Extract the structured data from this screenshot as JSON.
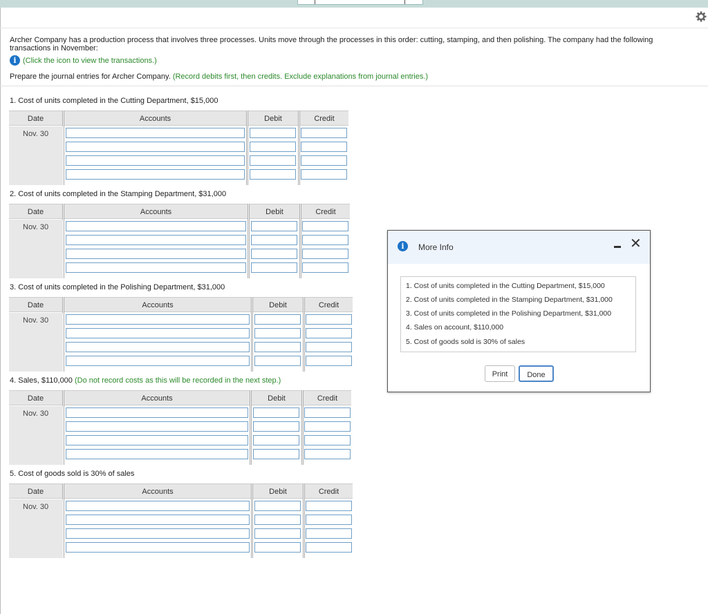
{
  "intro": "Archer Company has a production process that involves three processes. Units move through the processes in this order: cutting, stamping, and then polishing. The company had the following transactions in November:",
  "info_link": "(Click the icon to view the transactions.)",
  "prepare_text": "Prepare the journal entries for Archer Company.",
  "prepare_note": "(Record debits first, then credits. Exclude explanations from journal entries.)",
  "steps": [
    {
      "label": "1. Cost of units completed in the Cutting Department, $15,000",
      "note": ""
    },
    {
      "label": "2. Cost of units completed in the Stamping Department, $31,000",
      "note": ""
    },
    {
      "label": "3. Cost of units completed in the Polishing Department, $31,000",
      "note": ""
    },
    {
      "label": "4. Sales, $110,000",
      "note": "(Do not record costs as this will be recorded in the next step.)"
    },
    {
      "label": "5. Cost of goods sold is 30% of sales",
      "note": ""
    }
  ],
  "table_headers": {
    "date": "Date",
    "accounts": "Accounts",
    "debit": "Debit",
    "credit": "Credit"
  },
  "entry_date": "Nov. 30",
  "modal": {
    "title": "More Info",
    "items": [
      "1.  Cost of units completed in the Cutting Department, $15,000",
      "2.  Cost of units completed in the Stamping Department, $31,000",
      "3.  Cost of units completed in the Polishing Department, $31,000",
      "4.  Sales on account, $110,000",
      "5.  Cost of goods sold is 30% of sales"
    ],
    "print_label": "Print",
    "done_label": "Done"
  },
  "colors": {
    "accent": "#1a73c8",
    "note_green": "#2c8a2c",
    "input_border": "#6f9fc7"
  }
}
